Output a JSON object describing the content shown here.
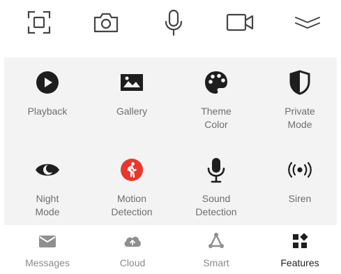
{
  "toolbar": {
    "icons": [
      "screenshot-icon",
      "camera-icon",
      "microphone-icon",
      "video-icon",
      "collapse-icon"
    ]
  },
  "features": [
    {
      "label": "Playback",
      "icon": "play-circle-icon"
    },
    {
      "label": "Gallery",
      "icon": "image-icon"
    },
    {
      "label": "Theme\nColor",
      "icon": "palette-icon"
    },
    {
      "label": "Private\nMode",
      "icon": "shield-icon"
    },
    {
      "label": "Night\nMode",
      "icon": "moon-eye-icon"
    },
    {
      "label": "Motion\nDetection",
      "icon": "walking-person-icon",
      "accent": "#e8382d"
    },
    {
      "label": "Sound\nDetection",
      "icon": "microphone-icon"
    },
    {
      "label": "Siren",
      "icon": "siren-icon"
    }
  ],
  "tabs": [
    {
      "label": "Messages",
      "icon": "message-icon"
    },
    {
      "label": "Cloud",
      "icon": "cloud-icon"
    },
    {
      "label": "Smart",
      "icon": "smart-icon"
    },
    {
      "label": "Features",
      "icon": "grid-icon",
      "active": true
    }
  ],
  "colors": {
    "icon_dark": "#1e1e1e",
    "accent_red": "#e8382d",
    "label_gray": "#6e6e6e",
    "panel_bg": "#f3f3f3"
  }
}
